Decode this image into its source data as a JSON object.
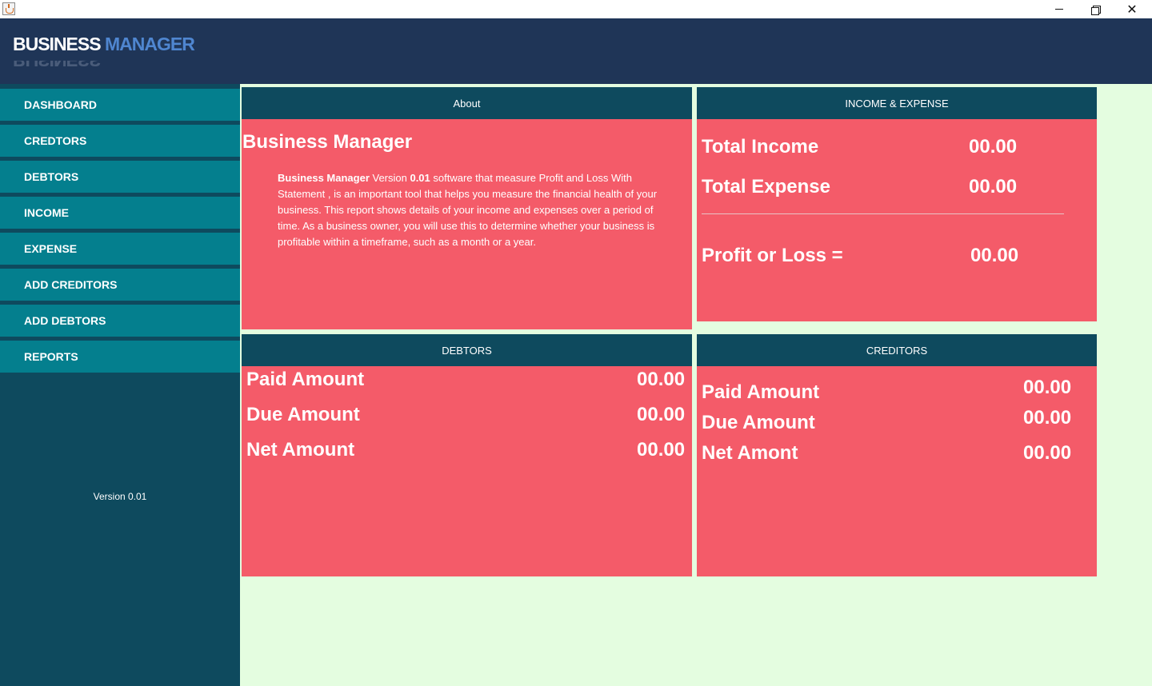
{
  "window": {
    "minimize_glyph": "",
    "close_glyph": "✕"
  },
  "header": {
    "logo_part1": "BUSINESS",
    "logo_part2": "MANAGER"
  },
  "sidebar": {
    "items": [
      {
        "label": "DASHBOARD"
      },
      {
        "label": "CREDTORS"
      },
      {
        "label": "DEBTORS"
      },
      {
        "label": "INCOME"
      },
      {
        "label": "EXPENSE"
      },
      {
        "label": "ADD CREDITORS"
      },
      {
        "label": "ADD DEBTORS"
      },
      {
        "label": "REPORTS"
      }
    ],
    "version": "Version 0.01"
  },
  "about": {
    "header": "About",
    "title": "Business Manager",
    "body_bold1": "Business Manager",
    "body_text1": " Version ",
    "body_bold2": "0.01",
    "body_text2": " software that measure Profit and Loss With Statement , is an important tool that helps you measure the financial health of your business. This report shows details of your income and expenses over a period of time. As a business owner, you will use this to determine whether your business is profitable within a timeframe, such as a month or a year."
  },
  "income_expense": {
    "header": "INCOME & EXPENSE",
    "total_income_label": "Total Income",
    "total_income_value": "00.00",
    "total_expense_label": "Total Expense",
    "total_expense_value": "00.00",
    "profit_label": "Profit or Loss  =",
    "profit_value": "00.00"
  },
  "debtors": {
    "header": "DEBTORS",
    "paid_label": "Paid Amount",
    "paid_value": "00.00",
    "due_label": "Due Amount",
    "due_value": "00.00",
    "net_label": "Net Amount",
    "net_value": "00.00"
  },
  "creditors": {
    "header": "CREDITORS",
    "paid_label": "Paid Amount",
    "paid_value": "00.00",
    "due_label": "Due Amount",
    "due_value": "00.00",
    "net_label": "Net Amont",
    "net_value": "00.00"
  },
  "colors": {
    "header_bg": "#1f3557",
    "sidebar_bg": "#0e4a5e",
    "nav_item_bg": "#047f8e",
    "panel_bg": "#f45b69",
    "panel_header_bg": "#0e4a5e",
    "workspace_bg": "#e4fde0"
  }
}
